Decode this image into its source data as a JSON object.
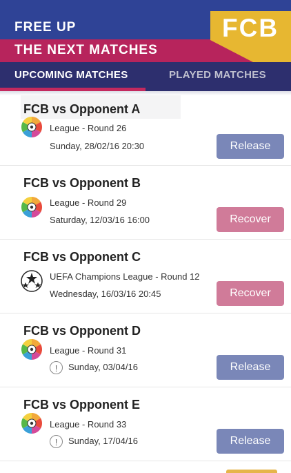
{
  "header": {
    "line1": "FREE UP",
    "line2": "THE NEXT MATCHES",
    "logo": "FCB",
    "colors": {
      "primary": "#2f4396",
      "band": "#b7245c",
      "logo": "#e7b731",
      "tabs": "#2d2f6e"
    }
  },
  "tabs": [
    {
      "label": "UPCOMING MATCHES",
      "active": true
    },
    {
      "label": "PLAYED MATCHES",
      "active": false
    }
  ],
  "matches": [
    {
      "title": "FCB vs Opponent A",
      "competition": "League - Round 26",
      "date": "Sunday, 28/02/16 20:30",
      "icon": "liga-logo-icon",
      "warning": false,
      "action": "Release"
    },
    {
      "title": "FCB vs Opponent B",
      "competition": "League - Round 29",
      "date": "Saturday, 12/03/16 16:00",
      "icon": "liga-logo-icon",
      "warning": false,
      "action": "Recover"
    },
    {
      "title": "FCB vs Opponent C",
      "competition": "UEFA Champions League - Round 12",
      "date": "Wednesday, 16/03/16 20:45",
      "icon": "champions-league-icon",
      "warning": false,
      "action": "Recover"
    },
    {
      "title": "FCB vs Opponent D",
      "competition": "League - Round 31",
      "date": "Sunday, 03/04/16",
      "icon": "liga-logo-icon",
      "warning": true,
      "action": "Release"
    },
    {
      "title": "FCB vs Opponent E",
      "competition": "League - Round 33",
      "date": "Sunday, 17/04/16",
      "icon": "liga-logo-icon",
      "warning": true,
      "action": "Release"
    }
  ],
  "warning_glyph": "!"
}
